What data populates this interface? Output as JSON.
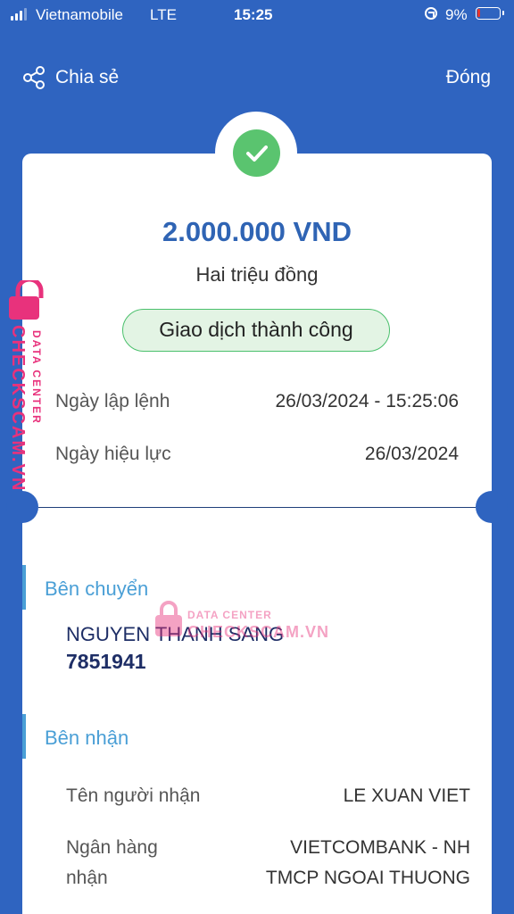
{
  "status_bar": {
    "carrier": "Vietnamobile",
    "network": "LTE",
    "time": "15:25",
    "battery": "9%"
  },
  "header": {
    "share_label": "Chia sẻ",
    "close_label": "Đóng"
  },
  "receipt": {
    "amount": "2.000.000 VND",
    "amount_words": "Hai triệu đồng",
    "status": "Giao dịch thành công",
    "created_label": "Ngày lập lệnh",
    "created_value": "26/03/2024 - 15:25:06",
    "effective_label": "Ngày hiệu lực",
    "effective_value": "26/03/2024"
  },
  "sender": {
    "title": "Bên chuyển",
    "name": "NGUYEN THANH SANG",
    "account": "7851941"
  },
  "receiver": {
    "title": "Bên nhận",
    "name_label": "Tên người nhận",
    "name_value": "LE XUAN VIET",
    "bank_label_line1": "Ngân hàng",
    "bank_label_line2": "nhận",
    "bank_value_line1": "VIETCOMBANK - NH",
    "bank_value_line2": "TMCP NGOAI THUONG"
  },
  "watermark": {
    "main": "CHECKSCAM.VN",
    "sub": "DATA CENTER"
  },
  "colors": {
    "background": "#2f64c0",
    "amount": "#2f64b4",
    "success": "#5ac46f",
    "section_accent": "#4a9fd6",
    "watermark": "#e8327c"
  },
  "icons": [
    "signal-icon",
    "lock-rotation-icon",
    "battery-icon",
    "share-icon",
    "check-icon",
    "watermark-lock-icon"
  ]
}
